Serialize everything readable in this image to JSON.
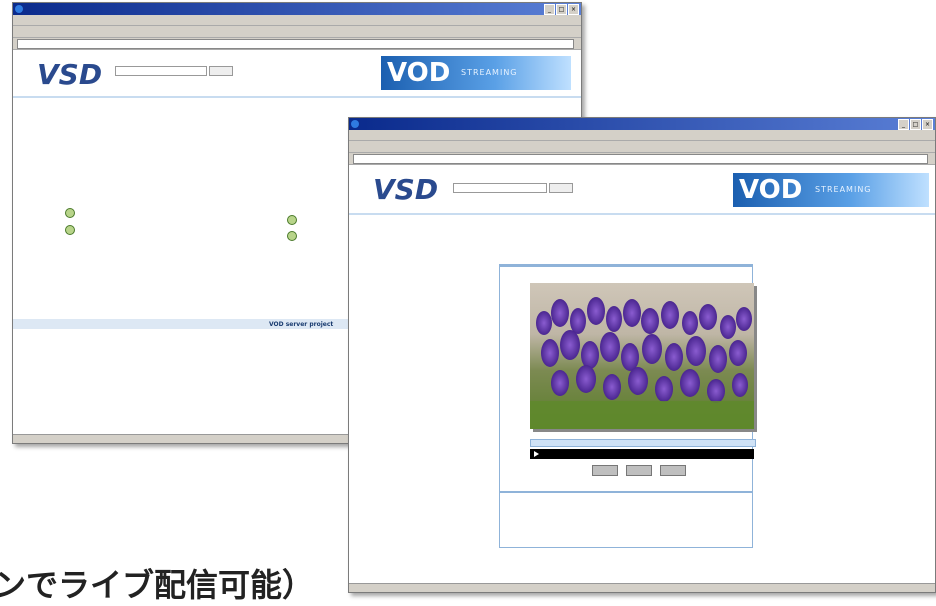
{
  "back_window": {
    "title": "",
    "menu": "",
    "toolbar": "",
    "address": "",
    "go": "",
    "logo": "VSD",
    "banner_vod": "VOD",
    "banner_streaming": "STREAMING",
    "footer_text": "VOD server project"
  },
  "front_window": {
    "title": "",
    "menu": "",
    "toolbar": "",
    "address": "",
    "go": "",
    "logo": "VSD",
    "banner_vod": "VOD",
    "banner_streaming": "STREAMING",
    "breadcrumb": "",
    "player_header": "",
    "section_header": "",
    "description": ""
  },
  "caption": "ンでライブ配信可能）"
}
